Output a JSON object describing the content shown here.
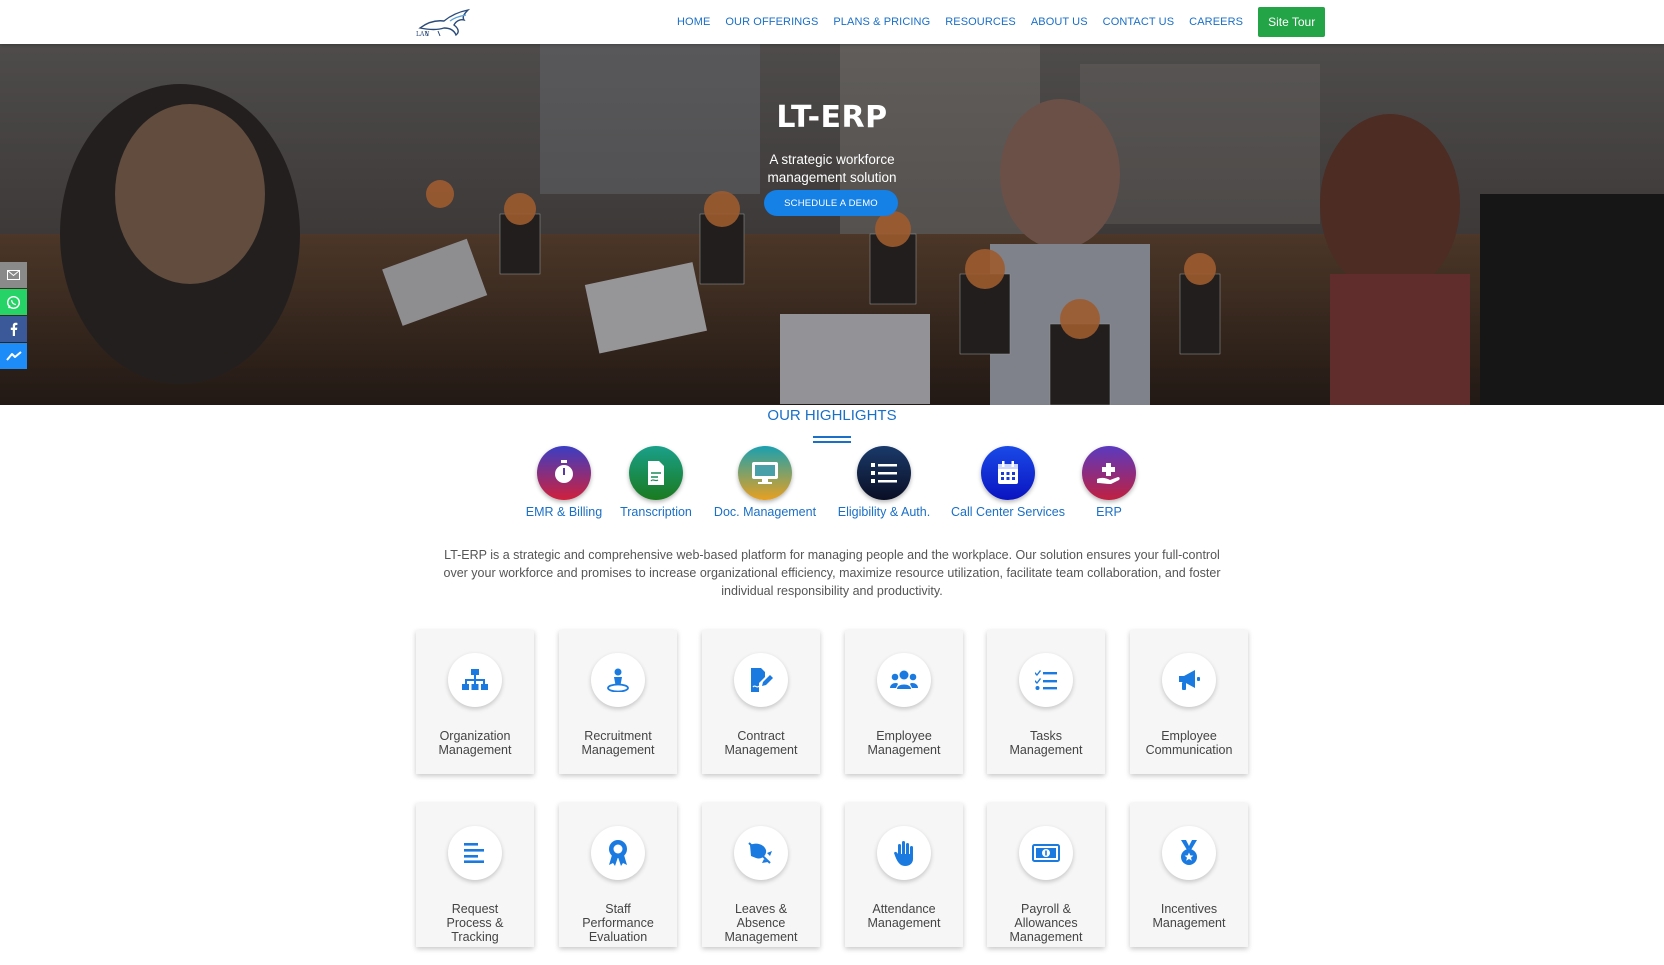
{
  "header": {
    "logo_icon": "horse-logo-icon",
    "logo_text": "LAU",
    "nav": [
      "HOME",
      "OUR OFFERINGS",
      "PLANS & PRICING",
      "RESOURCES",
      "ABOUT US",
      "CONTACT US",
      "CAREERS"
    ],
    "site_tour": "Site Tour"
  },
  "hero": {
    "title": "LT-ERP",
    "subtitle_line1": "A strategic workforce",
    "subtitle_line2": "management solution",
    "cta": "SCHEDULE A DEMO"
  },
  "social": [
    {
      "icon": "email-icon",
      "color": "#8a8a8a"
    },
    {
      "icon": "whatsapp-icon",
      "color": "#25d366"
    },
    {
      "icon": "facebook-icon",
      "color": "#3b5998"
    },
    {
      "icon": "messenger-icon",
      "color": "#1d8cf8"
    }
  ],
  "highlights": {
    "title": "OUR HIGHLIGHTS",
    "items": [
      {
        "label": "EMR & Billing",
        "icon": "stopwatch-icon"
      },
      {
        "label": "Transcription",
        "icon": "document-icon"
      },
      {
        "label": "Doc. Management",
        "icon": "monitor-icon"
      },
      {
        "label": "Eligibility & Auth.",
        "icon": "checklist-icon"
      },
      {
        "label": "Call Center Services",
        "icon": "calendar-icon"
      },
      {
        "label": "ERP",
        "icon": "hand-plus-icon"
      }
    ]
  },
  "description": {
    "line1": "LT-ERP is a strategic and comprehensive web-based platform for managing people and the workplace. Our solution ensures your full-control",
    "line2": "over your workforce and promises to increase organizational efficiency, maximize resource utilization, facilitate team collaboration, and foster",
    "line3": "individual responsibility and productivity."
  },
  "features": [
    {
      "line1": "Organization",
      "line2": "Management",
      "line3": "",
      "icon": "org-chart-icon"
    },
    {
      "line1": "Recruitment",
      "line2": "Management",
      "line3": "",
      "icon": "person-pin-icon"
    },
    {
      "line1": "Contract",
      "line2": "Management",
      "line3": "",
      "icon": "contract-sign-icon"
    },
    {
      "line1": "Employee",
      "line2": "Management",
      "line3": "",
      "icon": "users-icon"
    },
    {
      "line1": "Tasks",
      "line2": "Management",
      "line3": "",
      "icon": "task-list-icon"
    },
    {
      "line1": "Employee",
      "line2": "Communication",
      "line3": "",
      "icon": "megaphone-icon"
    },
    {
      "line1": "Request",
      "line2": "Process &",
      "line3": "Tracking",
      "icon": "align-left-icon"
    },
    {
      "line1": "Staff",
      "line2": "Performance",
      "line3": "Evaluation",
      "icon": "award-ribbon-icon"
    },
    {
      "line1": "Leaves &",
      "line2": "Absence",
      "line3": "Management",
      "icon": "leave-icon"
    },
    {
      "line1": "Attendance",
      "line2": "Management",
      "line3": "",
      "icon": "hand-icon"
    },
    {
      "line1": "Payroll &",
      "line2": "Allowances",
      "line3": "Management",
      "icon": "money-bill-icon"
    },
    {
      "line1": "Incentives",
      "line2": "Management",
      "line3": "",
      "icon": "medal-icon"
    }
  ]
}
